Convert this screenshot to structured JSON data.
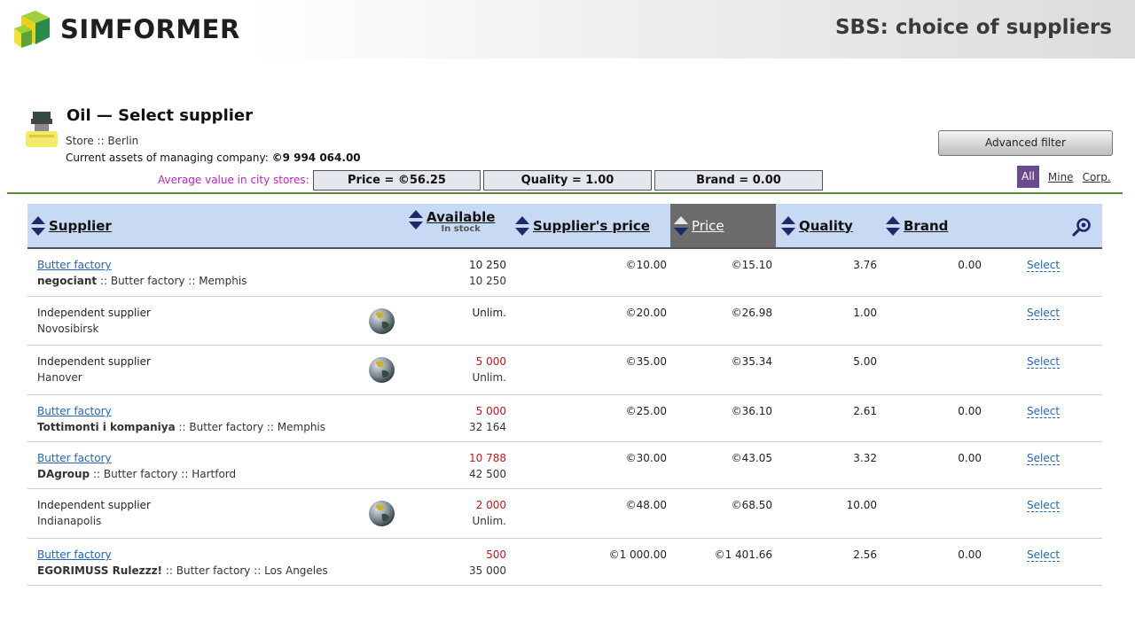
{
  "banner": {
    "logo_text": "SIMFORMER",
    "title": "SBS: choice of suppliers"
  },
  "header": {
    "title": "Oil — Select supplier",
    "store_line": "Store :: Berlin",
    "assets_label": "Current assets of managing company:",
    "assets_value": "©9 994 064.00",
    "avg_label": "Average value in city stores:",
    "avg_price": "Price = ©56.25",
    "avg_quality": "Quality = 1.00",
    "avg_brand": "Brand = 0.00",
    "advanced_filter": "Advanced filter",
    "tabs": {
      "all": "All",
      "mine": "Mine",
      "corp": "Corp."
    }
  },
  "columns": {
    "supplier": "Supplier",
    "available": "Available",
    "in_stock": "In stock",
    "supplier_price": "Supplier's price",
    "price": "Price",
    "quality": "Quality",
    "brand": "Brand"
  },
  "rows": [
    {
      "name": "Butter factory",
      "sub_bold": "negociant",
      "sub_rest": " :: Butter factory :: Memphis",
      "available": "10 250",
      "stock": "10 250",
      "supplier_price": "©10.00",
      "price": "©15.10",
      "quality": "3.76",
      "brand": "0.00",
      "select": "Select"
    },
    {
      "name": "Independent supplier",
      "sub_bold": "",
      "sub_rest": "Novosibirsk",
      "available": "Unlim.",
      "stock": "",
      "supplier_price": "©20.00",
      "price": "©26.98",
      "quality": "1.00",
      "brand": "",
      "select": "Select"
    },
    {
      "name": "Independent supplier",
      "sub_bold": "",
      "sub_rest": "Hanover",
      "available": "5 000",
      "stock": "Unlim.",
      "supplier_price": "©35.00",
      "price": "©35.34",
      "quality": "5.00",
      "brand": "",
      "select": "Select"
    },
    {
      "name": "Butter factory",
      "sub_bold": "Tottimonti i kompaniya",
      "sub_rest": " :: Butter factory :: Memphis",
      "available": "5 000",
      "stock": "32 164",
      "supplier_price": "©25.00",
      "price": "©36.10",
      "quality": "2.61",
      "brand": "0.00",
      "select": "Select"
    },
    {
      "name": "Butter factory",
      "sub_bold": "DAgroup",
      "sub_rest": " :: Butter factory :: Hartford",
      "available": "10 788",
      "stock": "42 500",
      "supplier_price": "©30.00",
      "price": "©43.05",
      "quality": "3.32",
      "brand": "0.00",
      "select": "Select"
    },
    {
      "name": "Independent supplier",
      "sub_bold": "",
      "sub_rest": "Indianapolis",
      "available": "2 000",
      "stock": "Unlim.",
      "supplier_price": "©48.00",
      "price": "©68.50",
      "quality": "10.00",
      "brand": "",
      "select": "Select"
    },
    {
      "name": "Butter factory",
      "sub_bold": "EGORIMUSS Rulezzz!",
      "sub_rest": " :: Butter factory :: Los Angeles",
      "available": "500",
      "stock": "35 000",
      "supplier_price": "©1 000.00",
      "price": "©1 401.66",
      "quality": "2.56",
      "brand": "0.00",
      "select": "Select"
    }
  ],
  "colors": {
    "header_bg": "#c8d9f4",
    "active_col": "#6b6b6b",
    "link": "#2266bb",
    "low_stock": "#c8181e",
    "avg_label": "#c020c8"
  }
}
